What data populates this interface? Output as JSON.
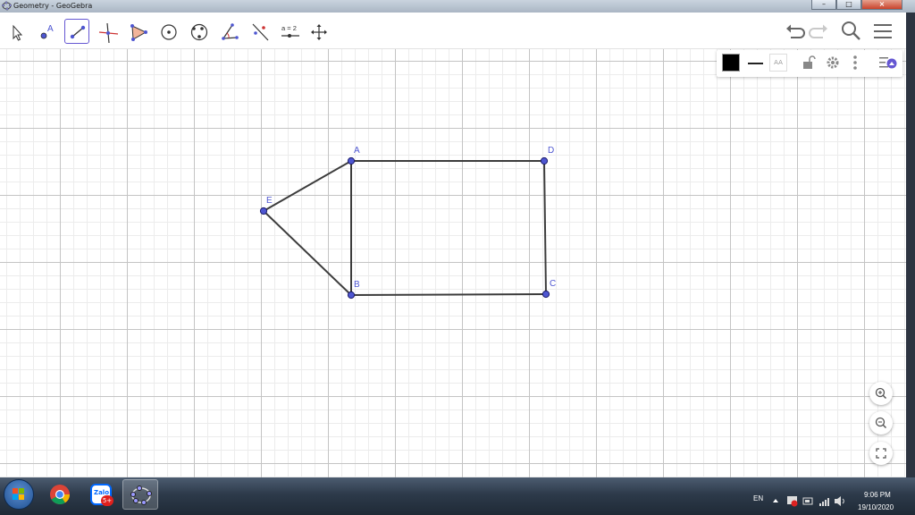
{
  "window": {
    "title": "Geometry - GeoGebra",
    "controls": [
      "minimize",
      "maximize",
      "close"
    ]
  },
  "toolbar": {
    "tools": [
      {
        "name": "move",
        "icon": "arrow-pointer-icon"
      },
      {
        "name": "point",
        "icon": "point-icon",
        "label": "A"
      },
      {
        "name": "segment",
        "icon": "segment-icon",
        "active": true
      },
      {
        "name": "perpendicular-line",
        "icon": "perpendicular-line-icon"
      },
      {
        "name": "polygon",
        "icon": "polygon-icon"
      },
      {
        "name": "circle-center-point",
        "icon": "circle-center-icon"
      },
      {
        "name": "circle-three-points",
        "icon": "circle-three-points-icon"
      },
      {
        "name": "angle",
        "icon": "angle-icon"
      },
      {
        "name": "reflect",
        "icon": "reflect-icon"
      },
      {
        "name": "slider",
        "icon": "slider-icon",
        "label": "a = 2"
      },
      {
        "name": "move-graphics-view",
        "icon": "move-view-icon"
      }
    ],
    "right": [
      "undo-icon",
      "redo-icon",
      "search-icon",
      "menu-icon"
    ]
  },
  "style_bar": {
    "color": "#000000",
    "label_style": "AA",
    "items": [
      "color-swatch-icon",
      "line-style-icon",
      "label-style-icon",
      "lock-icon",
      "settings-icon",
      "more-vertical-icon",
      "style-bar-toggle-icon"
    ]
  },
  "figure": {
    "points": [
      {
        "name": "A"
      },
      {
        "name": "B"
      },
      {
        "name": "C"
      },
      {
        "name": "D"
      },
      {
        "name": "E"
      }
    ],
    "segments": [
      [
        "A",
        "D"
      ],
      [
        "D",
        "C"
      ],
      [
        "C",
        "B"
      ],
      [
        "B",
        "A"
      ],
      [
        "A",
        "E"
      ],
      [
        "E",
        "B"
      ]
    ],
    "point_color": "#4e56d1",
    "segment_color": "#3c3c3c"
  },
  "zoom_controls": [
    "zoom-in-icon",
    "zoom-out-icon",
    "fullscreen-icon"
  ],
  "taskbar": {
    "apps": [
      "windows-start-icon",
      "chrome-icon",
      "zalo-icon",
      "geogebra-icon"
    ],
    "zalo_badge": "5+",
    "zalo_label": "Zalo",
    "language": "EN",
    "time": "9:06 PM",
    "date": "19/10/2020"
  }
}
